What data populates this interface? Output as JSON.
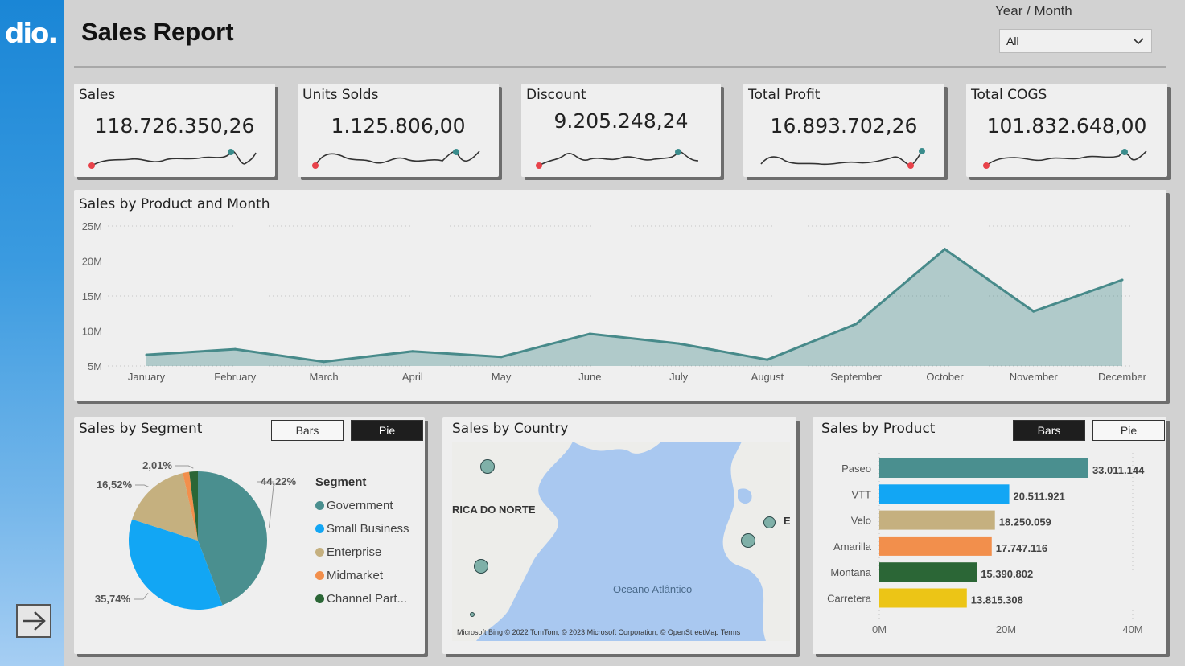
{
  "header": {
    "logo": "dio.",
    "title": "Sales Report",
    "slicer_label": "Year / Month",
    "slicer_value": "All"
  },
  "kpis": [
    {
      "title": "Sales",
      "value": "118.726.350,26"
    },
    {
      "title": "Units Solds",
      "value": "1.125.806,00"
    },
    {
      "title": "Discount",
      "value": "9.205.248,24"
    },
    {
      "title": "Total Profit",
      "value": "16.893.702,26"
    },
    {
      "title": "Total COGS",
      "value": "101.832.648,00"
    }
  ],
  "colors": {
    "teal": "#4a8f8f",
    "blue": "#12a6f4",
    "tan": "#c5b07f",
    "orange": "#f28f4c",
    "green": "#2b6636",
    "yellow": "#ecc516",
    "red": "#e8424a"
  },
  "line_chart": {
    "title": "Sales by Product and Month",
    "chart_data": {
      "type": "area",
      "categories": [
        "January",
        "February",
        "March",
        "April",
        "May",
        "June",
        "July",
        "August",
        "September",
        "October",
        "November",
        "December"
      ],
      "values": [
        6.6,
        7.4,
        5.6,
        7.1,
        6.3,
        9.6,
        8.2,
        5.9,
        11.0,
        21.7,
        12.8,
        17.3
      ],
      "y_ticks": [
        "25M",
        "20M",
        "15M",
        "10M",
        "5M"
      ],
      "ylim": [
        5,
        25
      ]
    }
  },
  "segment": {
    "title": "Sales by Segment",
    "toggle_bars": "Bars",
    "toggle_pie": "Pie",
    "legend_title": "Segment",
    "chart_data": {
      "type": "pie",
      "labels": [
        "Government",
        "Small Business",
        "Enterprise",
        "Midmarket",
        "Channel Part..."
      ],
      "values": [
        44.22,
        35.74,
        16.52,
        1.51,
        2.01
      ],
      "data_labels": [
        "44,22%",
        "35,74%",
        "16,52%",
        "2,01%"
      ]
    }
  },
  "country": {
    "title": "Sales by Country",
    "label_na": "RICA DO NORTE",
    "label_e": "E",
    "ocean": "Oceano Atlântico",
    "attribution": "Microsoft Bing © 2022 TomTom, © 2023 Microsoft Corporation, © OpenStreetMap  Terms"
  },
  "product": {
    "title": "Sales by Product",
    "toggle_bars": "Bars",
    "toggle_pie": "Pie",
    "chart_data": {
      "type": "bar",
      "categories": [
        "Paseo",
        "VTT",
        "Velo",
        "Amarilla",
        "Montana",
        "Carretera"
      ],
      "values": [
        33011144,
        20511921,
        18250059,
        17747116,
        15390802,
        13815308
      ],
      "data_labels": [
        "33.011.144",
        "20.511.921",
        "18.250.059",
        "17.747.116",
        "15.390.802",
        "13.815.308"
      ],
      "x_ticks": [
        "0M",
        "20M",
        "40M"
      ],
      "xlim": [
        0,
        40000000
      ]
    }
  }
}
